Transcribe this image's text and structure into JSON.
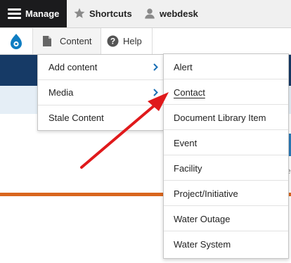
{
  "toolbar": {
    "manage_label": "Manage",
    "shortcuts_label": "Shortcuts",
    "user_label": "webdesk"
  },
  "admin_menu": {
    "content_label": "Content",
    "help_label": "Help"
  },
  "content_menu": {
    "items": [
      {
        "label": "Add content",
        "has_submenu": true
      },
      {
        "label": "Media",
        "has_submenu": true
      },
      {
        "label": "Stale Content",
        "has_submenu": false
      }
    ]
  },
  "add_content_submenu": {
    "items": [
      {
        "label": "Alert"
      },
      {
        "label": "Contact"
      },
      {
        "label": "Document Library Item"
      },
      {
        "label": "Event"
      },
      {
        "label": "Facility"
      },
      {
        "label": "Project/Initiative"
      },
      {
        "label": "Water Outage"
      },
      {
        "label": "Water System"
      }
    ]
  },
  "colors": {
    "manage_bg": "#1b1b1d",
    "toolbar_bg": "#f0f0f0",
    "drupal_blue": "#0f7dc2",
    "chevron_blue": "#1a6fb5",
    "arrow_red": "#e0191b",
    "header_navy": "#163a66",
    "accent_orange": "#d9661d"
  }
}
